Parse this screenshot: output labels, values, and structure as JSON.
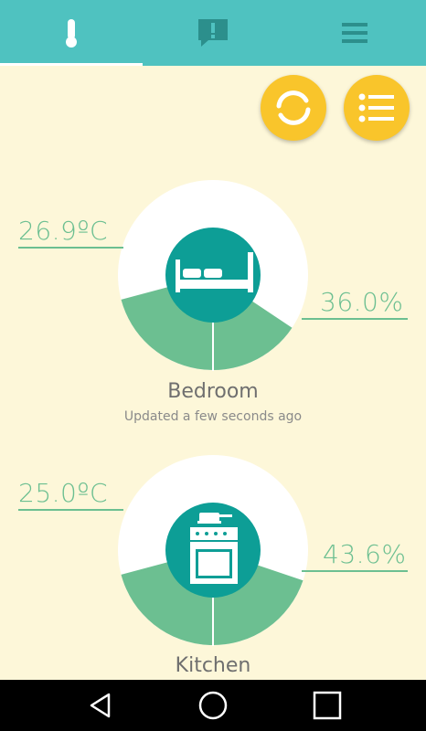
{
  "app": {
    "tabs": [
      {
        "icon": "thermometer-icon",
        "selected": true
      },
      {
        "icon": "alert-message-icon",
        "selected": false
      },
      {
        "icon": "menu-icon",
        "selected": false
      }
    ]
  },
  "actions": {
    "refresh_icon": "refresh-icon",
    "list_icon": "list-icon"
  },
  "rooms": [
    {
      "name": "Bedroom",
      "updated": "Updated a few seconds ago",
      "temperature": "26.9ºC",
      "humidity": "36.0%",
      "humidity_value": 36.0,
      "icon": "bed-icon"
    },
    {
      "name": "Kitchen",
      "updated": "",
      "temperature": "25.0ºC",
      "humidity": "43.6%",
      "humidity_value": 43.6,
      "icon": "stove-icon"
    }
  ],
  "colors": {
    "topbar": "#4fc2c0",
    "background": "#fdf7d9",
    "accent_green": "#6cbf91",
    "center_teal": "#0d9e96",
    "fab_yellow": "#f9c52b"
  }
}
